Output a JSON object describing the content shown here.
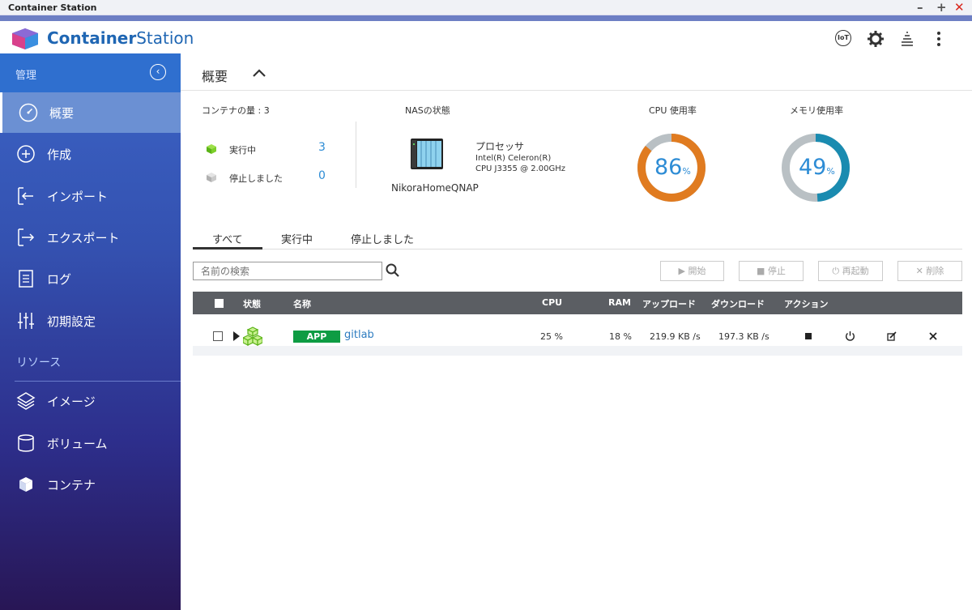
{
  "window": {
    "title": "Container Station",
    "controls": [
      "–",
      "+",
      "✕"
    ]
  },
  "header": {
    "brand_part1": "Container",
    "brand_part2": "Station",
    "icons": [
      "iot-icon",
      "gear-icon",
      "layers-icon",
      "more-vert-icon"
    ],
    "iot_label": "IoT"
  },
  "sidebar": {
    "manage_label": "管理",
    "items": [
      {
        "label": "概要",
        "icon": "dashboard-icon",
        "active": true
      },
      {
        "label": "作成",
        "icon": "plus-circle-icon"
      },
      {
        "label": "インポート",
        "icon": "import-icon"
      },
      {
        "label": "エクスポート",
        "icon": "export-icon"
      },
      {
        "label": "ログ",
        "icon": "log-icon"
      },
      {
        "label": "初期設定",
        "icon": "sliders-icon"
      }
    ],
    "resources_label": "リソース",
    "resource_items": [
      {
        "label": "イメージ",
        "icon": "layers-icon"
      },
      {
        "label": "ボリューム",
        "icon": "cylinder-icon"
      },
      {
        "label": "コンテナ",
        "icon": "cube-icon"
      }
    ]
  },
  "overview": {
    "title": "概要",
    "container_count_label": "コンテナの量 : 3",
    "running_label": "実行中",
    "running_count": "3",
    "stopped_label": "停止しました",
    "stopped_count": "0",
    "nas_label": "NASの状態",
    "processor_label": "プロセッサ",
    "processor_line1": "Intel(R) Celeron(R)",
    "processor_line2": "CPU J3355 @ 2.00GHz",
    "nas_name": "NikoraHomeQNAP",
    "cpu_label": "CPU 使用率",
    "cpu_value": "86",
    "cpu_fraction": 0.86,
    "mem_label": "メモリ使用率",
    "mem_value": "49",
    "mem_fraction": 0.49,
    "percent": "%",
    "colors": {
      "cpu": "#e07b20",
      "mem": "#1a8bb0",
      "track": "#b9c0c4"
    }
  },
  "tabs": [
    "すべて",
    "実行中",
    "停止しました"
  ],
  "toolbar": {
    "search_placeholder": "名前の検索",
    "start": "▶ 開始",
    "stop": "■ 停止",
    "restart": "⏻ 再起動",
    "delete": "✕ 削除"
  },
  "table": {
    "headers": {
      "status": "状態",
      "name": "名称",
      "cpu": "CPU",
      "ram": "RAM",
      "upload": "アップロード",
      "download": "ダウンロード",
      "action": "アクション"
    },
    "rows": [
      {
        "type": "APP",
        "name": "gitlab",
        "cpu": "25 %",
        "ram": "18 %",
        "upload": "219.9 KB /s",
        "download": "197.3 KB /s"
      }
    ]
  }
}
